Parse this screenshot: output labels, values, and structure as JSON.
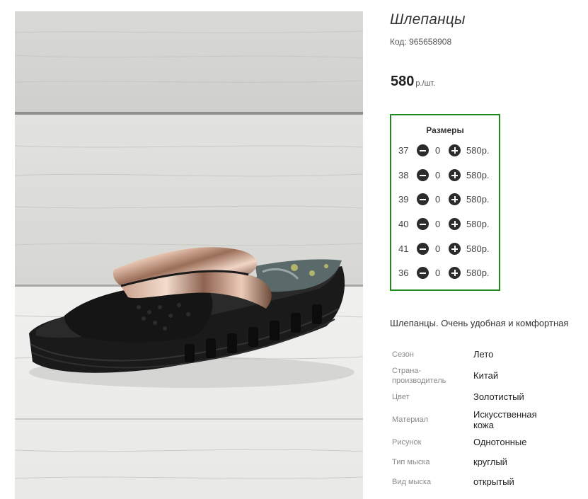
{
  "product": {
    "title": "Шлепанцы",
    "code_label": "Код:",
    "code_value": "965658908",
    "price_value": "580",
    "price_unit": "р./шт."
  },
  "sizes": {
    "title": "Размеры",
    "rows": [
      {
        "size": "37",
        "qty": "0",
        "price": "580р."
      },
      {
        "size": "38",
        "qty": "0",
        "price": "580р."
      },
      {
        "size": "39",
        "qty": "0",
        "price": "580р."
      },
      {
        "size": "40",
        "qty": "0",
        "price": "580р."
      },
      {
        "size": "41",
        "qty": "0",
        "price": "580р."
      },
      {
        "size": "36",
        "qty": "0",
        "price": "580р."
      }
    ]
  },
  "description": "Шлепанцы. Очень удобная и комфортная",
  "attributes": [
    {
      "key": "Сезон",
      "value": "Лето"
    },
    {
      "key": "Страна-производитель",
      "value": "Китай"
    },
    {
      "key": "Цвет",
      "value": "Золотистый"
    },
    {
      "key": "Материал",
      "value": "Искусственная кожа"
    },
    {
      "key": "Рисунок",
      "value": "Однотонные"
    },
    {
      "key": "Тип мыска",
      "value": "круглый"
    },
    {
      "key": "Вид мыска",
      "value": "открытый"
    }
  ],
  "icons": {
    "minus": "minus-circle-icon",
    "plus": "plus-circle-icon"
  },
  "colors": {
    "sizes_border": "#1e8a1e",
    "button": "#2b2b2b"
  }
}
